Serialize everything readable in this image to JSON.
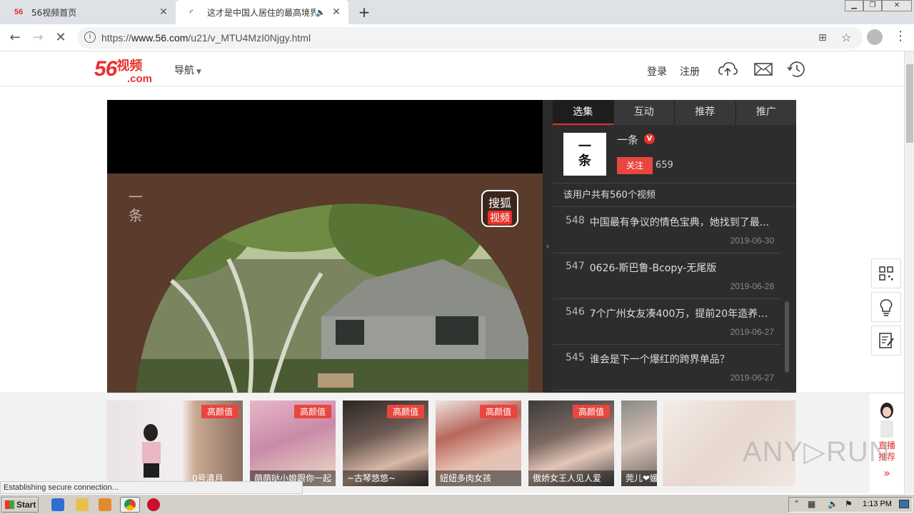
{
  "browser": {
    "tabs": [
      {
        "favicon": "56",
        "title": "56视频首页",
        "active": false
      },
      {
        "title": "这才是中国人居住的最高境界:",
        "active": true
      }
    ],
    "url_prefix": "https://",
    "url_host": "www.56.com",
    "url_path": "/u21/v_MTU4MzI0Njgy.html"
  },
  "site": {
    "logo_num": "56",
    "logo_text": "视频",
    "logo_com": ".com",
    "nav_label": "导航",
    "login": "登录",
    "register": "注册",
    "icons": [
      "upload-cloud-icon",
      "mail-icon",
      "history-icon"
    ]
  },
  "player": {
    "badge_top": "搜狐",
    "badge_bottom": "视频"
  },
  "side": {
    "tabs": [
      "选集",
      "互动",
      "推荐",
      "推广"
    ],
    "uploader_avatar_line1": "一",
    "uploader_avatar_line2": "条",
    "uploader_name": "一条",
    "verified": "V",
    "follow": "关注",
    "fans": "659",
    "total": "该用户共有560个视频",
    "videos": [
      {
        "num": "548",
        "title": "中国最有争议的情色宝典，她找到了最...",
        "date": "2019-06-30"
      },
      {
        "num": "547",
        "title": "0626-斯巴鲁-Bcopy-无尾版",
        "date": "2019-06-28"
      },
      {
        "num": "546",
        "title": "7个广州女友凑400万，提前20年造养老...",
        "date": "2019-06-27"
      },
      {
        "num": "545",
        "title": "谁会是下一个爆红的跨界单品？",
        "date": "2019-06-27"
      }
    ]
  },
  "float_tools": [
    "qrcode-icon",
    "lightbulb-icon",
    "feedback-icon"
  ],
  "strip": {
    "cards": [
      {
        "tag": "高颜值",
        "caption": "0号清月"
      },
      {
        "tag": "高颜值",
        "caption": "萌萌哒小娘跟你一起"
      },
      {
        "tag": "高颜值",
        "caption": "~古琴悠悠~"
      },
      {
        "tag": "高颜值",
        "caption": "妞妞多肉女孩"
      },
      {
        "tag": "高颜值",
        "caption": "傲娇女王人见人爱"
      },
      {
        "tag": "",
        "caption": "莞儿❤媛"
      }
    ],
    "live_line1": "直播",
    "live_line2": "推荐",
    "live_arrow": "»"
  },
  "status": "Establishing secure connection...",
  "watermark": "ANY▷RUN",
  "taskbar": {
    "start": "Start",
    "clock": "1:13 PM"
  }
}
